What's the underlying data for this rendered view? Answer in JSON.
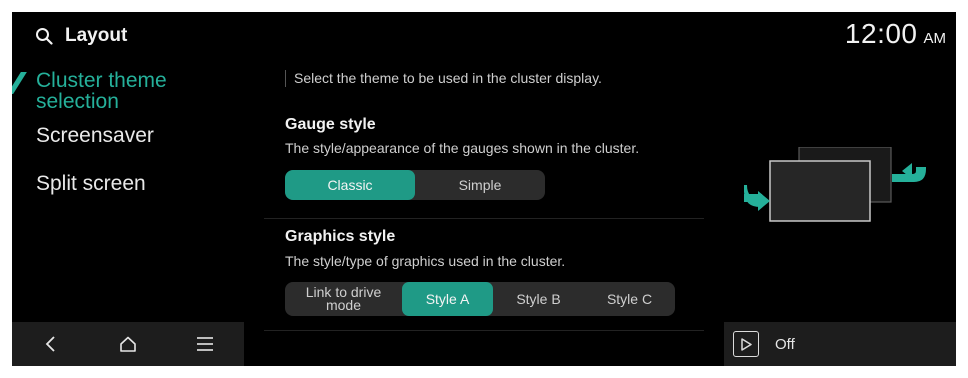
{
  "header": {
    "title": "Layout",
    "time": "12:00",
    "ampm": "AM"
  },
  "sidebar": {
    "items": [
      {
        "label": "Cluster theme selection",
        "active": true
      },
      {
        "label": "Screensaver",
        "active": false
      },
      {
        "label": "Split screen",
        "active": false
      }
    ]
  },
  "main": {
    "intro": "Select the theme to be used in the cluster display.",
    "gauge": {
      "title": "Gauge style",
      "description": "The style/appearance of the gauges shown in the cluster.",
      "options": [
        "Classic",
        "Simple"
      ],
      "selected": "Classic"
    },
    "graphics": {
      "title": "Graphics style",
      "description": "The style/type of graphics used in the cluster.",
      "options": [
        "Link to drive mode",
        "Style A",
        "Style B",
        "Style C"
      ],
      "selected": "Style A"
    }
  },
  "screensaver_toggle": {
    "label": "Off"
  },
  "colors": {
    "accent": "#25b09a",
    "background": "#000000",
    "panel": "#1d1d1d"
  },
  "icons": [
    "search-icon",
    "back-icon",
    "home-icon",
    "menu-icon",
    "play-icon",
    "swap-arrow-icon"
  ]
}
